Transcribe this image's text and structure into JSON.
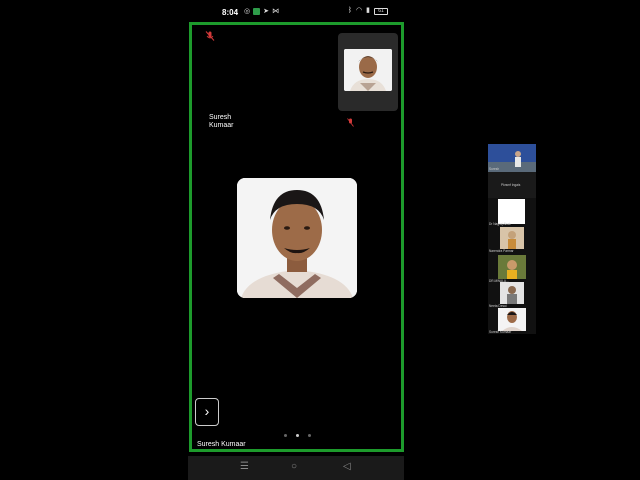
{
  "status_bar": {
    "time": "8:04",
    "battery": "61"
  },
  "meeting": {
    "thumbnail": {
      "name": "Suresh Kumaar"
    },
    "active_speaker": "Suresh Kumaar",
    "pages": {
      "count": 3,
      "current": 2
    }
  },
  "gallery": {
    "participants": [
      {
        "name": "Suresh"
      },
      {
        "name": "Pkrsmf Ingais"
      },
      {
        "name": "Dr Nagraj Alrak"
      },
      {
        "name": "Narendra Parmar"
      },
      {
        "name": "DR.MWALA..."
      },
      {
        "name": "Neeta Desai"
      },
      {
        "name": "Suresh Kumaar"
      }
    ]
  },
  "colors": {
    "frame_border": "#1d9b2c",
    "mute_red": "#d33a3a"
  },
  "icons": [
    "microphone-muted-icon",
    "chevron-right-icon",
    "wifi-icon",
    "bluetooth-icon"
  ]
}
